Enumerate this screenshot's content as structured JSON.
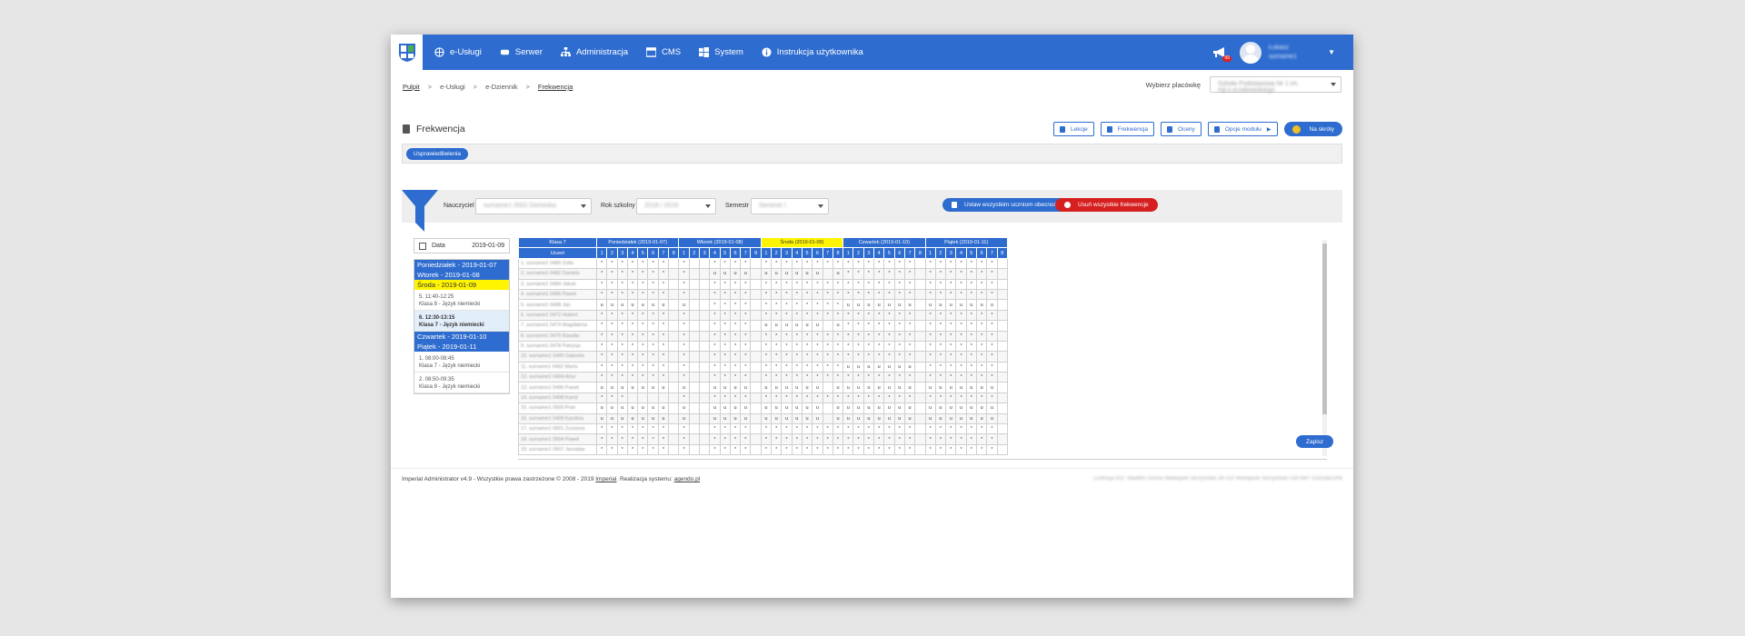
{
  "nav": {
    "items": [
      {
        "label": "e-Usługi",
        "icon": "globe-icon"
      },
      {
        "label": "Serwer",
        "icon": "server-icon"
      },
      {
        "label": "Administracja",
        "icon": "sitemap-icon"
      },
      {
        "label": "CMS",
        "icon": "cms-icon"
      },
      {
        "label": "System",
        "icon": "windows-icon"
      },
      {
        "label": "Instrukcja użytkownika",
        "icon": "info-icon"
      }
    ],
    "notification_badge": "99",
    "user_name_line1": "Łukasz",
    "user_name_line2": "surname1"
  },
  "breadcrumb": [
    "Pulpit",
    "e-Usługi",
    "e-Dziennik",
    "Frekwencja"
  ],
  "facility": {
    "label": "Wybierz placówkę",
    "value": "Szkoła Podstawowa Nr 1 im. mjr.Łuczakowskiego"
  },
  "page": {
    "title": "Frekwencja",
    "buttons": [
      "Lekcje",
      "Frekwencja",
      "Oceny",
      "Opcje modułu",
      "Na skróty"
    ],
    "subbar_pill": "Usprawiedliwienia"
  },
  "filters": {
    "teacher_label": "Nauczyciel",
    "teacher_value": "surname1 0002 Dominika",
    "year_label": "Rok szkolny",
    "year_value": "2018 / 2019",
    "semester_label": "Semestr",
    "semester_value": "Semestr I",
    "btn_set_presence": "Ustaw wszystkim uczniom obecność",
    "btn_delete": "Usuń wszystkie frekwencje"
  },
  "day_panel": {
    "date_label": "Data",
    "date_value": "2019-01-09",
    "days": [
      {
        "label": "Poniedziałek - 2019-01-07",
        "highlight": false,
        "lessons": []
      },
      {
        "label": "Wtorek - 2019-01-08",
        "highlight": false,
        "lessons": []
      },
      {
        "label": "Środa - 2019-01-09",
        "highlight": true,
        "lessons": [
          {
            "time": "5. 11:40-12:25",
            "name": "Klasa 8 - Język niemiecki",
            "active": false
          },
          {
            "time": "6. 12:30-13:15",
            "name": "Klasa 7 - Język niemiecki",
            "active": true
          }
        ]
      },
      {
        "label": "Czwartek - 2019-01-10",
        "highlight": false,
        "lessons": []
      },
      {
        "label": "Piątek - 2019-01-11",
        "highlight": false,
        "lessons": [
          {
            "time": "1. 08:00-08:45",
            "name": "Klasa 7 - Język niemiecki",
            "active": false
          },
          {
            "time": "2. 08:50-09:35",
            "name": "Klasa 8 - Język niemiecki",
            "active": false
          }
        ]
      }
    ]
  },
  "grid": {
    "class_label": "Klasa 7",
    "student_header": "Uczeń",
    "days": [
      {
        "label": "Poniedziałek (2019-01-07)",
        "today": false
      },
      {
        "label": "Wtorek (2019-01-08)",
        "today": false
      },
      {
        "label": "Środa (2019-01-09)",
        "today": true
      },
      {
        "label": "Czwartek (2019-01-10)",
        "today": false
      },
      {
        "label": "Piątek (2019-01-11)",
        "today": false
      }
    ],
    "periods": [
      "1",
      "2",
      "3",
      "4",
      "5",
      "6",
      "7",
      "8"
    ],
    "students": [
      {
        "name": "1. surname1 0480 Zofia",
        "marks": [
          "*******",
          "*  ****",
          "********",
          "*******",
          "*******"
        ]
      },
      {
        "name": "2. surname1 0482 Daniela",
        "marks": [
          "*******",
          "*  uuuu",
          "uuuuuu u",
          "*******",
          "*******"
        ]
      },
      {
        "name": "3. surname1 0484 Jakub",
        "marks": [
          "*******",
          "*  ****",
          "********",
          "*******",
          "*******"
        ]
      },
      {
        "name": "4. surname1 0486 Paweł",
        "marks": [
          "*******",
          "*  ****",
          "********",
          "*******",
          "*******"
        ]
      },
      {
        "name": "5. surname1 0488 Jan",
        "marks": [
          "uuuuuuu",
          "u  ****",
          "********",
          "uuuuuuu",
          "uuuuuuu"
        ]
      },
      {
        "name": "6. surname1 0472 Hubert",
        "marks": [
          "*******",
          "*  ****",
          "********",
          "*******",
          "*******"
        ]
      },
      {
        "name": "7. surname1 0474 Magdalena",
        "marks": [
          "*******",
          "*  ****",
          "uuuuuu u",
          "*******",
          "*******"
        ]
      },
      {
        "name": "8. surname1 0476 Klaudia",
        "marks": [
          "*******",
          "*  ****",
          "********",
          "*******",
          "*******"
        ]
      },
      {
        "name": "9. surname1 0478 Patrycja",
        "marks": [
          "*******",
          "*  ****",
          "********",
          "*******",
          "*******"
        ]
      },
      {
        "name": "10. surname1 0490 Gabriela",
        "marks": [
          "*******",
          "*  ****",
          "********",
          "*******",
          "*******"
        ]
      },
      {
        "name": "11. surname1 0492 Maria",
        "marks": [
          "*******",
          "*  ****",
          "********",
          "uuuuuuu",
          "*******"
        ]
      },
      {
        "name": "12. surname1 0494 Artur",
        "marks": [
          "*******",
          "*  ****",
          "********",
          "*******",
          "*******"
        ]
      },
      {
        "name": "13. surname1 0496 Paweł",
        "marks": [
          "uuuuuuu",
          "u  uuuu",
          "uuuuuu u",
          "uuuuuuu",
          "uuuuuuu"
        ]
      },
      {
        "name": "14. surname1 0498 Kamil",
        "marks": [
          "***    ",
          "*  ****",
          "********",
          "*******",
          "*******"
        ]
      },
      {
        "name": "15. surname1 0500 Piotr",
        "marks": [
          "uuuuuuu",
          "u  uuuu",
          "uuuuuu u",
          "uuuuuuu",
          "uuuuuuu"
        ]
      },
      {
        "name": "16. surname1 0499 Karolina",
        "marks": [
          "uuuuuuu",
          "u  uuuu",
          "uuuuuu u",
          "uuuuuuu",
          "uuuuuuu"
        ]
      },
      {
        "name": "17. surname1 0501 Zuzanna",
        "marks": [
          "*******",
          "*  ****",
          "********",
          "*******",
          "*******"
        ]
      },
      {
        "name": "18. surname1 0504 Paweł",
        "marks": [
          "*******",
          "*  ****",
          "********",
          "*******",
          "*******"
        ]
      },
      {
        "name": "19. surname1 0507 Jarosław",
        "marks": [
          "*******",
          "*  ****",
          "********",
          "*******",
          "*******"
        ]
      }
    ]
  },
  "save_label": "Zapisz",
  "footer": {
    "left_prefix": "Imperial Administrator v4.9 - Wszystkie prawa zastrzeżone © 2008 - 2019 ",
    "left_link1": "Imperial",
    "left_mid": ". Realizacja systemu: ",
    "left_link2": "agendo.pl",
    "right": "Licencja 002: Wadiffo Gmina Wiełopole Skrzyńskie 39-110 Wiełopole Skrzyńskie 039 NIP: 8181862306"
  },
  "colors": {
    "primary": "#2e6ccf",
    "today": "#fff500",
    "danger": "#d62020"
  }
}
